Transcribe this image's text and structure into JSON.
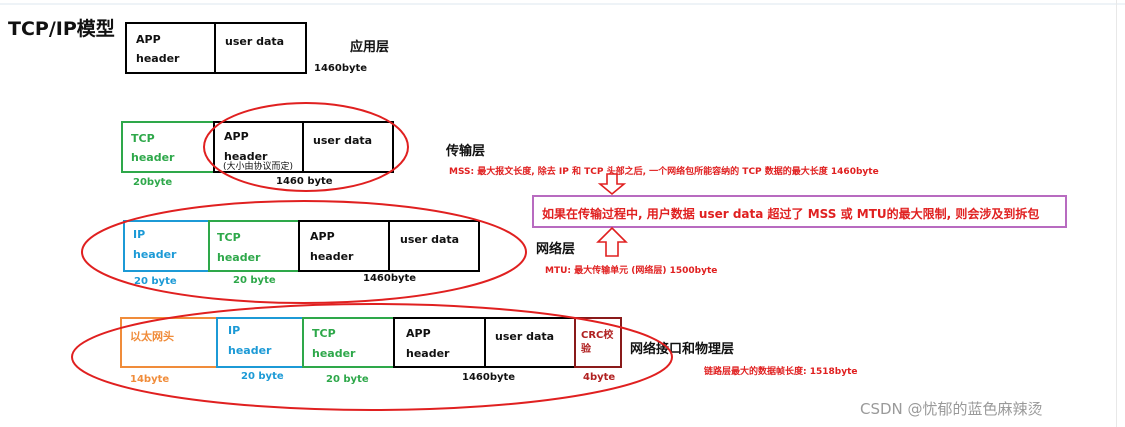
{
  "title": "TCP/IP模型",
  "layers": {
    "app": {
      "name": "应用层",
      "app_header": [
        "APP",
        "header"
      ],
      "user_data": "user data",
      "size": "1460byte"
    },
    "transport": {
      "name": "传输层",
      "tcp_header": [
        "TCP",
        "header"
      ],
      "tcp_size": "20byte",
      "app_header": [
        "APP",
        "header"
      ],
      "app_note": "(大小由协议而定)",
      "user_data": "user data",
      "size": "1460 byte",
      "mss_note": "MSS:  最大报文长度,   除去 IP 和 TCP 头部之后, 一个网络包所能容纳的 TCP 数据的最大长度  1460byte"
    },
    "network": {
      "name": "网络层",
      "ip_header": [
        "IP",
        "header"
      ],
      "ip_size": "20 byte",
      "tcp_header": [
        "TCP",
        "header"
      ],
      "tcp_size": "20 byte",
      "app_header": [
        "APP",
        "header"
      ],
      "user_data": "user data",
      "size": "1460byte",
      "mtu_note": "MTU:  最大传输单元 (网络层)      1500byte"
    },
    "link": {
      "name": "网络接口和物理层",
      "eth_header": "以太网头",
      "eth_size": "14byte",
      "ip_header": [
        "IP",
        "header"
      ],
      "ip_size": "20 byte",
      "tcp_header": [
        "TCP",
        "header"
      ],
      "tcp_size": "20 byte",
      "app_header": [
        "APP",
        "header"
      ],
      "user_data": "user data",
      "size": "1460byte",
      "crc": "CRC校验",
      "crc_size": "4byte",
      "frame_note": "链路层最大的数据帧长度:  1518byte"
    }
  },
  "fragment_note": "如果在传输过程中, 用户数据 user data 超过了 MSS 或 MTU的最大限制, 则会涉及到拆包",
  "watermark": "CSDN @忧郁的蓝色麻辣烫",
  "colors": {
    "green": "#2ea84a",
    "blue": "#1c9ad6",
    "orange": "#f08c3a",
    "maroon": "#8a1a1a",
    "red": "#e02020",
    "purple": "#b86bc0"
  }
}
